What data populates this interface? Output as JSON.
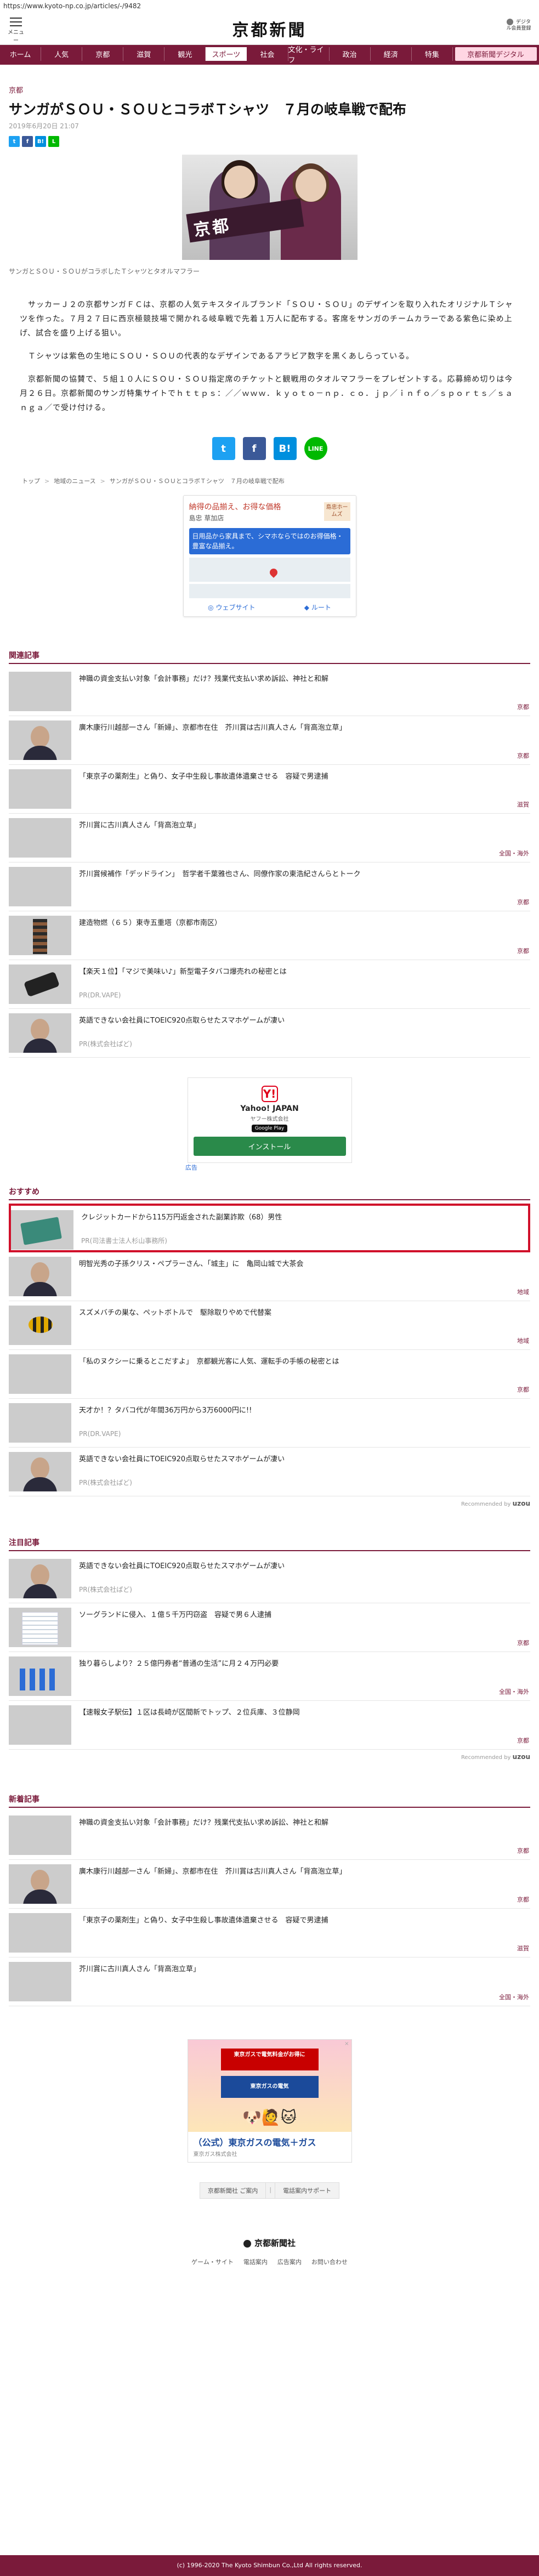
{
  "url": "https://www.kyoto-np.co.jp/articles/-/9482",
  "header": {
    "menu_label": "メニュー",
    "logo": "京都新聞",
    "member_label": "デジタル会員登録"
  },
  "gnav": [
    {
      "label": "ホーム"
    },
    {
      "label": "人気"
    },
    {
      "label": "京都"
    },
    {
      "label": "滋賀"
    },
    {
      "label": "観光"
    },
    {
      "label": "スポーツ",
      "active": true
    },
    {
      "label": "社会"
    },
    {
      "label": "文化・ライフ"
    },
    {
      "label": "政治"
    },
    {
      "label": "経済"
    },
    {
      "label": "特集"
    },
    {
      "label": "京都新聞デジタル",
      "wide": true
    }
  ],
  "article": {
    "section": "京都",
    "headline": "サンガがＳＯＵ・ＳＯＵとコラボＴシャツ　７月の岐阜戦で配布",
    "date": "2019年6月20日 21:07",
    "caption": "サンガとＳＯＵ・ＳＯＵがコラボしたＴシャツとタオルマフラー",
    "scarf_text": "京都",
    "paragraphs": [
      "　サッカーＪ２の京都サンガＦＣは、京都の人気テキスタイルブランド「ＳＯＵ・ＳＯＵ」のデザインを取り入れたオリジナルＴシャツを作った。７月２７日に西京極競技場で開かれる岐阜戦で先着１万人に配布する。客席をサンガのチームカラーである紫色に染め上げ、試合を盛り上げる狙い。",
      "　Ｔシャツは紫色の生地にＳＯＵ・ＳＯＵの代表的なデザインであるアラビア数字を黒くあしらっている。",
      "　京都新聞の協賛で、５組１０人にＳＯＵ・ＳＯＵ指定席のチケットと観戦用のタオルマフラーをプレゼントする。応募締め切りは今月２６日。京都新聞のサンガ特集サイトでｈｔｔｐｓ：／／ｗｗｗ．ｋｙｏｔｏ－ｎｐ．ｃｏ．ｊｐ／ｉｎｆｏ／ｓｐｏｒｔｓ／ｓａｎｇａ／で受け付ける。"
    ]
  },
  "share_small": [
    {
      "name": "twitter",
      "label": "t",
      "color": "#1da1f2"
    },
    {
      "name": "facebook",
      "label": "f",
      "color": "#3b5998"
    },
    {
      "name": "hatena",
      "label": "B!",
      "color": "#008fde"
    },
    {
      "name": "line",
      "label": "L",
      "color": "#00b900"
    }
  ],
  "share_big": [
    {
      "name": "twitter",
      "label": "t",
      "color": "#1da1f2"
    },
    {
      "name": "facebook",
      "label": "f",
      "color": "#3b5998"
    },
    {
      "name": "hatena",
      "label": "B!",
      "color": "#008fde"
    },
    {
      "name": "line",
      "label": "LINE",
      "color": "#00b900"
    }
  ],
  "breadcrumb": [
    "トップ",
    "地域のニュース",
    "サンガがＳＯＵ・ＳＯＵとコラボＴシャツ　７月の岐阜戦で配布"
  ],
  "map_ad": {
    "title": "納得の品揃え、お得な価格",
    "subtitle": "島忠 草加店",
    "logo": "島忠ホームズ",
    "blue_text": "日用品から家具まで、シマホならではのお得価格・豊富な品揃え。",
    "link1": "ウェブサイト",
    "link2": "ルート"
  },
  "related": {
    "heading": "関連記事",
    "items": [
      {
        "title": "神職の資金支払い対象「会計事務」だけ？残業代支払い求め訴訟、神社と和解",
        "cat": "京都",
        "thumb": "t-temple"
      },
      {
        "title": "廣木康行川越部一さん「新婦」、京都市在住　芥川賞は古川真人さん「背高泡立草」",
        "cat": "京都",
        "thumb": "t-person"
      },
      {
        "title": "「東京子の薬剤生」と偽り、女子中生殺し事故遺体遺棄させる　容疑で男逮捕",
        "cat": "滋賀",
        "thumb": "t-building"
      },
      {
        "title": "芥川賞に古川真人さん「背高泡立草」",
        "cat": "全国・海外",
        "thumb": "t-street"
      },
      {
        "title": "芥川賞候補作「デッドライン」　哲学者千葉雅也さん、同僚作家の東浩紀さんらとトーク",
        "cat": "京都",
        "thumb": "t-dark"
      },
      {
        "title": "建造物燃（６５）東寺五重塔（京都市南区）",
        "cat": "京都",
        "thumb": "t-pagoda"
      },
      {
        "title": "【楽天１位】「マジで美味い♪」新型電子タバコ爆売れの秘密とは",
        "pr": "PR(DR.VAPE)",
        "thumb": "t-device"
      },
      {
        "title": "英語できない会社員にTOEIC920点取らせたスマホゲームが凄い",
        "pr": "PR(株式会社ぱど)",
        "thumb": "t-person"
      }
    ]
  },
  "yahoo_ad": {
    "name": "Yahoo! JAPAN",
    "sub": "ヤフー株式会社",
    "store": "Google Play",
    "button": "インストール",
    "tag": "広告"
  },
  "recommend": {
    "heading": "おすすめ",
    "items": [
      {
        "title": "クレジットカードから115万円返金された副業詐欺（68）男性",
        "pr": "PR(司法書士法人杉山事務所)",
        "thumb": "t-card",
        "highlight": true
      },
      {
        "title": "明智光秀の子孫クリス・ペプラーさん、「城主」に　亀岡山城で大茶会",
        "cat": "地域",
        "thumb": "t-person"
      },
      {
        "title": "スズメバチの巣な、ペットボトルで　駆除取りやめで代替案",
        "cat": "地域",
        "thumb": "t-wasp"
      },
      {
        "title": "「私のヌクシーに乗るとこだすよ」　京都観光客に人気、運転手の手帳の秘密とは",
        "cat": "京都",
        "thumb": "t-street"
      },
      {
        "title": "天才か！？タバコ代が年間36万円から3万6000円に!!",
        "pr": "PR(DR.VAPE)",
        "thumb": "t-food"
      },
      {
        "title": "英語できない会社員にTOEIC920点取らせたスマホゲームが凄い",
        "pr": "PR(株式会社ぱど)",
        "thumb": "t-person"
      }
    ],
    "rec_by": "Recommended by",
    "rec_brand": "uzou"
  },
  "attention": {
    "heading": "注目記事",
    "items": [
      {
        "title": "英語できない会社員にTOEIC920点取らせたスマホゲームが凄い",
        "pr": "PR(株式会社ぱど)",
        "thumb": "t-person"
      },
      {
        "title": "ソーグランドに侵入、１億５千万円窃盗　容疑で男６人逮捕",
        "cat": "京都",
        "thumb": "t-doc"
      },
      {
        "title": "独り暮らしより？２５億円券者“普通の生活”に月２４万円必要",
        "cat": "全国・海外",
        "thumb": "t-chart"
      },
      {
        "title": "【速報女子駅伝】１区は長崎が区間新でトップ、２位兵庫、３位静岡",
        "cat": "京都",
        "thumb": "t-green"
      }
    ],
    "rec_by": "Recommended by",
    "rec_brand": "uzou"
  },
  "newest": {
    "heading": "新着記事",
    "items": [
      {
        "title": "神職の資金支払い対象「会計事務」だけ？残業代支払い求め訴訟、神社と和解",
        "cat": "京都",
        "thumb": "t-temple"
      },
      {
        "title": "廣木康行川越部一さん「新婦」、京都市在住　芥川賞は古川真人さん「背高泡立草」",
        "cat": "京都",
        "thumb": "t-person"
      },
      {
        "title": "「東京子の薬剤生」と偽り、女子中生殺し事故遺体遺棄させる　容疑で男逮捕",
        "cat": "滋賀",
        "thumb": "t-building"
      },
      {
        "title": "芥川賞に古川真人さん「背高泡立草」",
        "cat": "全国・海外",
        "thumb": "t-street"
      }
    ]
  },
  "gas_ad": {
    "badge": "東京ガスで電気料金がお得に",
    "mid": "東京ガスの電気",
    "chars": "🐶🙋🐱",
    "title": "（公式）東京ガスの電気＋ガス",
    "sub": "東京ガス株式会社",
    "close": "×"
  },
  "footer": {
    "link1": "京都新聞社 ご案内",
    "sep": "|",
    "link2": "電話案内サポート",
    "logo": "京都新聞社",
    "nav": [
      "ゲーム・サイト",
      "電話案内",
      "広告案内",
      "お問い合わせ"
    ],
    "copyright": "(c) 1996-2020 The Kyoto Shimbun Co.,Ltd All rights reserved."
  }
}
